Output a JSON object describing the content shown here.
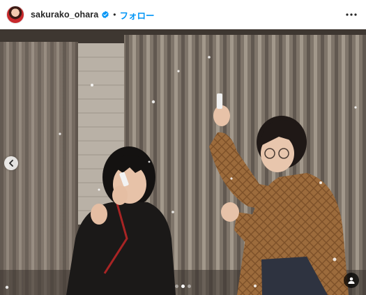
{
  "header": {
    "username": "sakurako_ohara",
    "separator": "•",
    "follow_label": "フォロー",
    "verified_icon": "verified-badge-icon",
    "more_icon": "more-horizontal-icon"
  },
  "photo": {
    "carousel": {
      "total_slides": 3,
      "active_slide": 2
    },
    "icons": {
      "previous": "chevron-left-icon",
      "user_tag": "user-tag-icon"
    }
  },
  "colors": {
    "follow_blue": "#0095f6",
    "verified_blue": "#0095f6",
    "text": "#262626"
  }
}
